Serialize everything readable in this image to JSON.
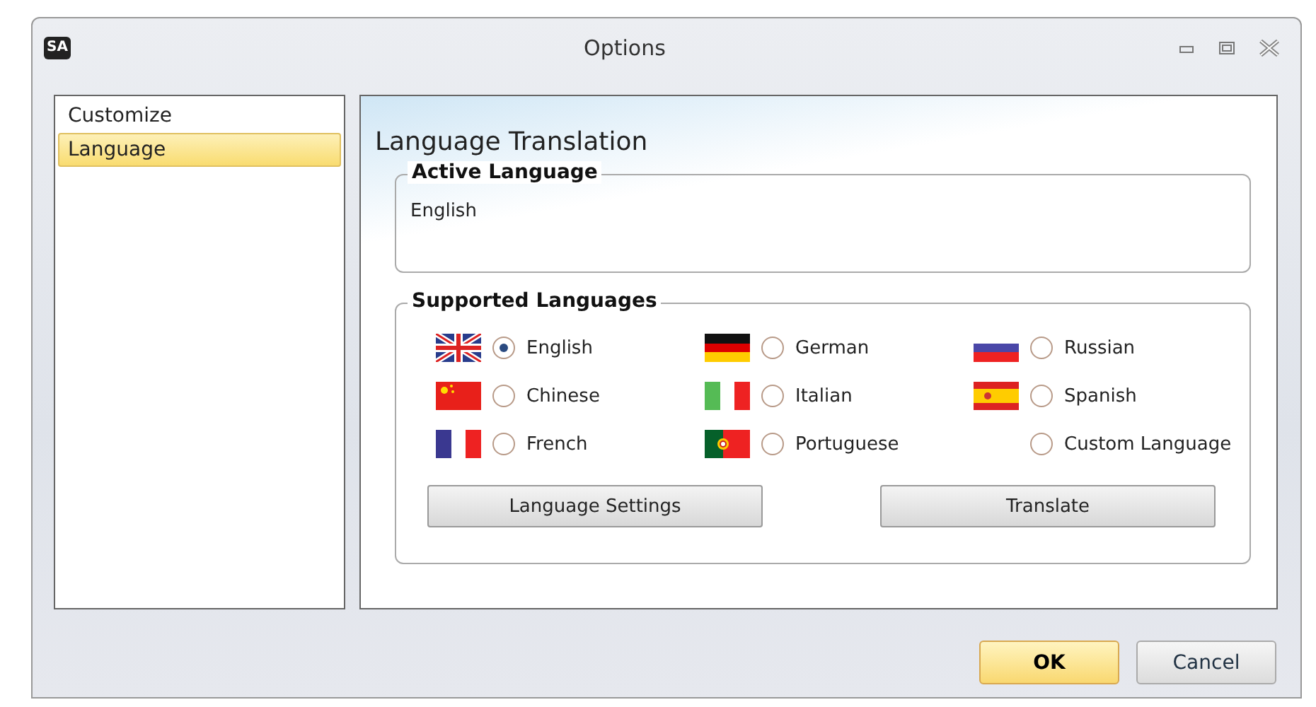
{
  "window": {
    "title": "Options",
    "app_icon": "SA"
  },
  "sidebar": {
    "items": [
      {
        "label": "Customize",
        "selected": false
      },
      {
        "label": "Language",
        "selected": true
      }
    ]
  },
  "panel": {
    "title": "Language Translation",
    "active_language": {
      "heading": "Active Language",
      "value": "English"
    },
    "supported_languages": {
      "heading": "Supported Languages",
      "options": [
        {
          "label": "English",
          "kind": "uk",
          "selected": true
        },
        {
          "label": "German",
          "kind": "de",
          "selected": false
        },
        {
          "label": "Russian",
          "kind": "ru",
          "selected": false
        },
        {
          "label": "Chinese",
          "kind": "cn",
          "selected": false
        },
        {
          "label": "Italian",
          "kind": "it",
          "selected": false
        },
        {
          "label": "Spanish",
          "kind": "es",
          "selected": false
        },
        {
          "label": "French",
          "kind": "fr",
          "selected": false
        },
        {
          "label": "Portuguese",
          "kind": "pt",
          "selected": false
        },
        {
          "label": "Custom Language",
          "kind": "plain",
          "selected": false
        }
      ],
      "buttons": [
        "Language Settings",
        "Translate"
      ]
    }
  },
  "footer": {
    "ok": "OK",
    "cancel": "Cancel"
  }
}
